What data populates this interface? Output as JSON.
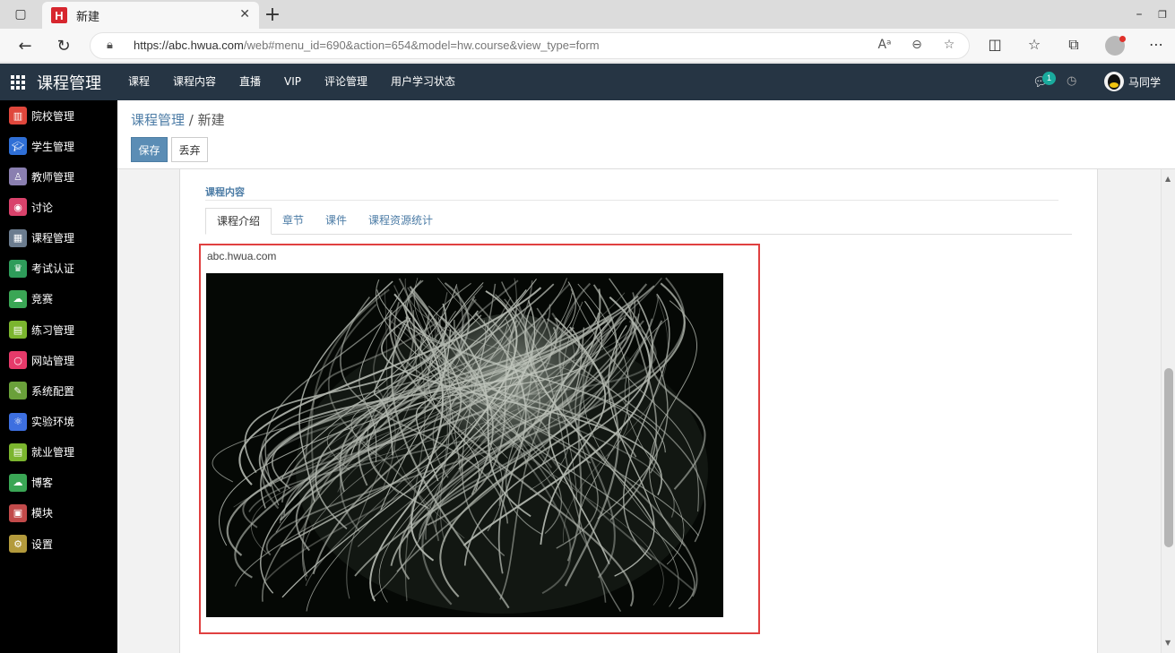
{
  "browser": {
    "tab_title": "新建",
    "favicon_letter": "H",
    "url_host": "https://abc.hwua.com",
    "url_rest": "/web#menu_id=690&action=654&model=hw.course&view_type=form"
  },
  "appnav": {
    "brand": "课程管理",
    "menu": [
      "课程",
      "课程内容",
      "直播",
      "VIP",
      "评论管理",
      "用户学习状态"
    ],
    "chat_badge": "1",
    "username": "马同学"
  },
  "sidebar": {
    "items": [
      {
        "label": "院校管理",
        "icon": "building-icon",
        "color": "#e0473c"
      },
      {
        "label": "学生管理",
        "icon": "graduation-cap-icon",
        "color": "#2f6fd6"
      },
      {
        "label": "教师管理",
        "icon": "teacher-icon",
        "color": "#8a7fb0"
      },
      {
        "label": "讨论",
        "icon": "chat-bubble-icon",
        "color": "#d9426b"
      },
      {
        "label": "课程管理",
        "icon": "calendar-grid-icon",
        "color": "#6b7c8f"
      },
      {
        "label": "考试认证",
        "icon": "trophy-icon",
        "color": "#2e9c5a"
      },
      {
        "label": "竞赛",
        "icon": "cloud-icon",
        "color": "#3aa655"
      },
      {
        "label": "练习管理",
        "icon": "notebook-icon",
        "color": "#7bb52e"
      },
      {
        "label": "网站管理",
        "icon": "ring-icon",
        "color": "#e63a6a"
      },
      {
        "label": "系统配置",
        "icon": "wrench-icon",
        "color": "#6aa03a"
      },
      {
        "label": "实验环境",
        "icon": "atom-icon",
        "color": "#3d6fe0"
      },
      {
        "label": "就业管理",
        "icon": "notebook-icon",
        "color": "#7bb52e"
      },
      {
        "label": "博客",
        "icon": "cloud-icon",
        "color": "#3aa655"
      },
      {
        "label": "模块",
        "icon": "cubes-icon",
        "color": "#c24a4a"
      },
      {
        "label": "设置",
        "icon": "gear-icon",
        "color": "#b39a3c"
      }
    ]
  },
  "header": {
    "breadcrumb_parent": "课程管理",
    "breadcrumb_sep": " / ",
    "breadcrumb_current": "新建",
    "save_label": "保存",
    "discard_label": "丢弃"
  },
  "form": {
    "group_title": "课程内容",
    "tabs": [
      "课程介绍",
      "章节",
      "课件",
      "课程资源统计"
    ],
    "active_tab": 0,
    "content_caption": "abc.hwua.com"
  }
}
